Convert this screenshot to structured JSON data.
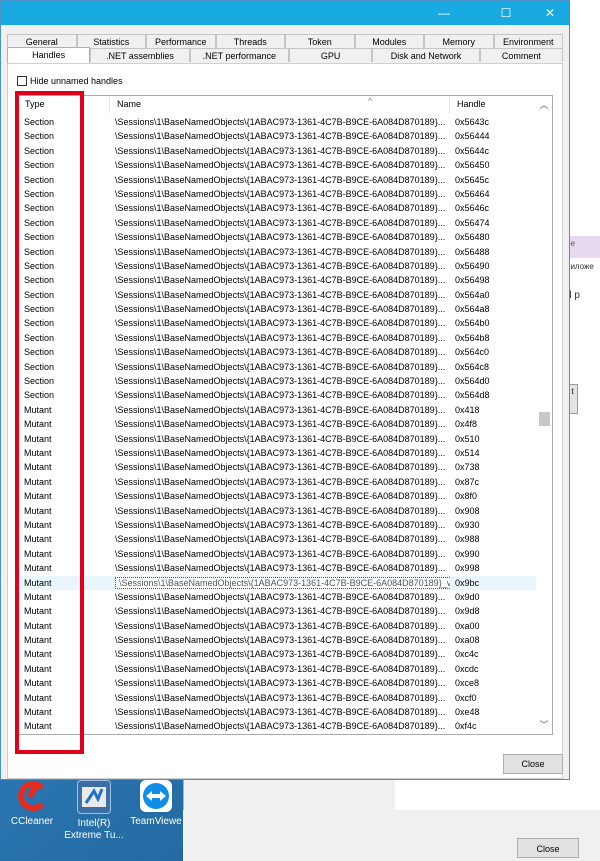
{
  "tabs_row1": [
    "General",
    "Statistics",
    "Performance",
    "Threads",
    "Token",
    "Modules",
    "Memory",
    "Environment"
  ],
  "tabs_row2": [
    "Handles",
    ".NET assemblies",
    ".NET performance",
    "GPU",
    "Disk and Network",
    "Comment"
  ],
  "active_tab": "Handles",
  "hide_unnamed_label": "Hide unnamed handles",
  "columns": {
    "type": "Type",
    "name": "Name",
    "handle": "Handle"
  },
  "rows": [
    {
      "type": "Section",
      "name": "\\Sessions\\1\\BaseNamedObjects\\{1ABAC973-1361-4C7B-B9CE-6A084D870189}...",
      "handle": "0x5643c"
    },
    {
      "type": "Section",
      "name": "\\Sessions\\1\\BaseNamedObjects\\{1ABAC973-1361-4C7B-B9CE-6A084D870189}...",
      "handle": "0x56444"
    },
    {
      "type": "Section",
      "name": "\\Sessions\\1\\BaseNamedObjects\\{1ABAC973-1361-4C7B-B9CE-6A084D870189}...",
      "handle": "0x5644c"
    },
    {
      "type": "Section",
      "name": "\\Sessions\\1\\BaseNamedObjects\\{1ABAC973-1361-4C7B-B9CE-6A084D870189}...",
      "handle": "0x56450"
    },
    {
      "type": "Section",
      "name": "\\Sessions\\1\\BaseNamedObjects\\{1ABAC973-1361-4C7B-B9CE-6A084D870189}...",
      "handle": "0x5645c"
    },
    {
      "type": "Section",
      "name": "\\Sessions\\1\\BaseNamedObjects\\{1ABAC973-1361-4C7B-B9CE-6A084D870189}...",
      "handle": "0x56464"
    },
    {
      "type": "Section",
      "name": "\\Sessions\\1\\BaseNamedObjects\\{1ABAC973-1361-4C7B-B9CE-6A084D870189}...",
      "handle": "0x5646c"
    },
    {
      "type": "Section",
      "name": "\\Sessions\\1\\BaseNamedObjects\\{1ABAC973-1361-4C7B-B9CE-6A084D870189}...",
      "handle": "0x56474"
    },
    {
      "type": "Section",
      "name": "\\Sessions\\1\\BaseNamedObjects\\{1ABAC973-1361-4C7B-B9CE-6A084D870189}...",
      "handle": "0x56480"
    },
    {
      "type": "Section",
      "name": "\\Sessions\\1\\BaseNamedObjects\\{1ABAC973-1361-4C7B-B9CE-6A084D870189}...",
      "handle": "0x56488"
    },
    {
      "type": "Section",
      "name": "\\Sessions\\1\\BaseNamedObjects\\{1ABAC973-1361-4C7B-B9CE-6A084D870189}...",
      "handle": "0x56490"
    },
    {
      "type": "Section",
      "name": "\\Sessions\\1\\BaseNamedObjects\\{1ABAC973-1361-4C7B-B9CE-6A084D870189}...",
      "handle": "0x56498"
    },
    {
      "type": "Section",
      "name": "\\Sessions\\1\\BaseNamedObjects\\{1ABAC973-1361-4C7B-B9CE-6A084D870189}...",
      "handle": "0x564a0"
    },
    {
      "type": "Section",
      "name": "\\Sessions\\1\\BaseNamedObjects\\{1ABAC973-1361-4C7B-B9CE-6A084D870189}...",
      "handle": "0x564a8"
    },
    {
      "type": "Section",
      "name": "\\Sessions\\1\\BaseNamedObjects\\{1ABAC973-1361-4C7B-B9CE-6A084D870189}...",
      "handle": "0x564b0"
    },
    {
      "type": "Section",
      "name": "\\Sessions\\1\\BaseNamedObjects\\{1ABAC973-1361-4C7B-B9CE-6A084D870189}...",
      "handle": "0x564b8"
    },
    {
      "type": "Section",
      "name": "\\Sessions\\1\\BaseNamedObjects\\{1ABAC973-1361-4C7B-B9CE-6A084D870189}...",
      "handle": "0x564c0"
    },
    {
      "type": "Section",
      "name": "\\Sessions\\1\\BaseNamedObjects\\{1ABAC973-1361-4C7B-B9CE-6A084D870189}...",
      "handle": "0x564c8"
    },
    {
      "type": "Section",
      "name": "\\Sessions\\1\\BaseNamedObjects\\{1ABAC973-1361-4C7B-B9CE-6A084D870189}...",
      "handle": "0x564d0"
    },
    {
      "type": "Section",
      "name": "\\Sessions\\1\\BaseNamedObjects\\{1ABAC973-1361-4C7B-B9CE-6A084D870189}...",
      "handle": "0x564d8"
    },
    {
      "type": "Mutant",
      "name": "\\Sessions\\1\\BaseNamedObjects\\{1ABAC973-1361-4C7B-B9CE-6A084D870189}...",
      "handle": "0x418"
    },
    {
      "type": "Mutant",
      "name": "\\Sessions\\1\\BaseNamedObjects\\{1ABAC973-1361-4C7B-B9CE-6A084D870189}...",
      "handle": "0x4f8"
    },
    {
      "type": "Mutant",
      "name": "\\Sessions\\1\\BaseNamedObjects\\{1ABAC973-1361-4C7B-B9CE-6A084D870189}...",
      "handle": "0x510"
    },
    {
      "type": "Mutant",
      "name": "\\Sessions\\1\\BaseNamedObjects\\{1ABAC973-1361-4C7B-B9CE-6A084D870189}...",
      "handle": "0x514"
    },
    {
      "type": "Mutant",
      "name": "\\Sessions\\1\\BaseNamedObjects\\{1ABAC973-1361-4C7B-B9CE-6A084D870189}...",
      "handle": "0x738"
    },
    {
      "type": "Mutant",
      "name": "\\Sessions\\1\\BaseNamedObjects\\{1ABAC973-1361-4C7B-B9CE-6A084D870189}...",
      "handle": "0x87c"
    },
    {
      "type": "Mutant",
      "name": "\\Sessions\\1\\BaseNamedObjects\\{1ABAC973-1361-4C7B-B9CE-6A084D870189}...",
      "handle": "0x8f0"
    },
    {
      "type": "Mutant",
      "name": "\\Sessions\\1\\BaseNamedObjects\\{1ABAC973-1361-4C7B-B9CE-6A084D870189}...",
      "handle": "0x908"
    },
    {
      "type": "Mutant",
      "name": "\\Sessions\\1\\BaseNamedObjects\\{1ABAC973-1361-4C7B-B9CE-6A084D870189}...",
      "handle": "0x930"
    },
    {
      "type": "Mutant",
      "name": "\\Sessions\\1\\BaseNamedObjects\\{1ABAC973-1361-4C7B-B9CE-6A084D870189}...",
      "handle": "0x988"
    },
    {
      "type": "Mutant",
      "name": "\\Sessions\\1\\BaseNamedObjects\\{1ABAC973-1361-4C7B-B9CE-6A084D870189}...",
      "handle": "0x990"
    },
    {
      "type": "Mutant",
      "name": "\\Sessions\\1\\BaseNamedObjects\\{1ABAC973-1361-4C7B-B9CE-6A084D870189}...",
      "handle": "0x998"
    },
    {
      "type": "Mutant",
      "name": "\\Sessions\\1\\BaseNamedObjects\\{1ABAC973-1361-4C7B-B9CE-6A084D870189}_v2_0",
      "handle": "0x9bc",
      "selected": true
    },
    {
      "type": "Mutant",
      "name": "\\Sessions\\1\\BaseNamedObjects\\{1ABAC973-1361-4C7B-B9CE-6A084D870189}...",
      "handle": "0x9d0"
    },
    {
      "type": "Mutant",
      "name": "\\Sessions\\1\\BaseNamedObjects\\{1ABAC973-1361-4C7B-B9CE-6A084D870189}...",
      "handle": "0x9d8"
    },
    {
      "type": "Mutant",
      "name": "\\Sessions\\1\\BaseNamedObjects\\{1ABAC973-1361-4C7B-B9CE-6A084D870189}...",
      "handle": "0xa00"
    },
    {
      "type": "Mutant",
      "name": "\\Sessions\\1\\BaseNamedObjects\\{1ABAC973-1361-4C7B-B9CE-6A084D870189}...",
      "handle": "0xa08"
    },
    {
      "type": "Mutant",
      "name": "\\Sessions\\1\\BaseNamedObjects\\{1ABAC973-1361-4C7B-B9CE-6A084D870189}...",
      "handle": "0xc4c"
    },
    {
      "type": "Mutant",
      "name": "\\Sessions\\1\\BaseNamedObjects\\{1ABAC973-1361-4C7B-B9CE-6A084D870189}...",
      "handle": "0xcdc"
    },
    {
      "type": "Mutant",
      "name": "\\Sessions\\1\\BaseNamedObjects\\{1ABAC973-1361-4C7B-B9CE-6A084D870189}...",
      "handle": "0xce8"
    },
    {
      "type": "Mutant",
      "name": "\\Sessions\\1\\BaseNamedObjects\\{1ABAC973-1361-4C7B-B9CE-6A084D870189}...",
      "handle": "0xcf0"
    },
    {
      "type": "Mutant",
      "name": "\\Sessions\\1\\BaseNamedObjects\\{1ABAC973-1361-4C7B-B9CE-6A084D870189}...",
      "handle": "0xe48"
    },
    {
      "type": "Mutant",
      "name": "\\Sessions\\1\\BaseNamedObjects\\{1ABAC973-1361-4C7B-B9CE-6A084D870189}...",
      "handle": "0xf4c"
    }
  ],
  "close_label": "Close",
  "back_window": {
    "strip1": "ие",
    "strip2": "риложе",
    "strip3": "d  p",
    "strip4": "t t",
    "close_label": "Close"
  },
  "desktop_icons": [
    {
      "label": "CCleaner",
      "icon": "ccleaner-icon"
    },
    {
      "label": "Intel(R) Extreme Tu...",
      "icon": "intel-xtu-icon"
    },
    {
      "label": "TeamViewe",
      "icon": "teamviewer-icon"
    }
  ],
  "colors": {
    "titlebar": "#18a9e0",
    "highlight_box": "#e0001b",
    "desktop": "#2b77b4"
  }
}
